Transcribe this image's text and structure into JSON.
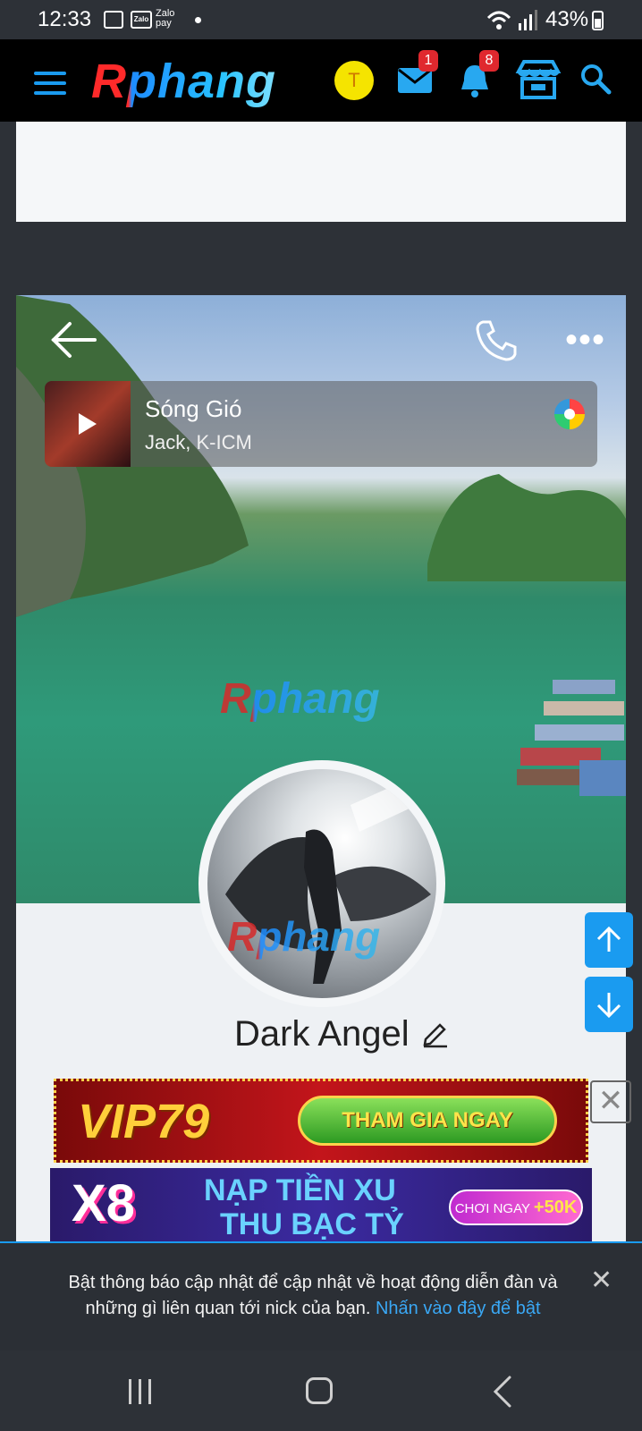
{
  "status_bar": {
    "time": "12:33",
    "app_icons": [
      "image-icon",
      "zalo-icon",
      "zalo-pay-icon"
    ],
    "zalo_label": "Zalo",
    "zalo_pay_label": "Zalo pay",
    "battery": "43%"
  },
  "header": {
    "brand": "Rphang",
    "user_initial": "T",
    "messages_count": "1",
    "notifications_count": "8",
    "icons": [
      "menu-icon",
      "mail-icon",
      "bell-icon",
      "store-icon",
      "search-icon"
    ],
    "accent_color": "#1a9bf0"
  },
  "cover": {
    "watermark": "Rphang",
    "music": {
      "title": "Sóng Gió",
      "artist": "Jack, K-ICM"
    }
  },
  "profile": {
    "name": "Dark Angel",
    "avatar_watermark": "Rphang"
  },
  "ads": {
    "ad1": {
      "logo": "VIP79",
      "button": "THAM GIA NGAY"
    },
    "ad2": {
      "logo": "X8",
      "line1": "NẠP TIỀN XU",
      "line2": "THU BẠC TỶ",
      "pill_label": "CHƠI NGAY",
      "pill_bonus": "+50K"
    }
  },
  "notification": {
    "message": "Bật thông báo cập nhật để cập nhật về hoạt động diễn đàn và những gì liên quan tới nick của bạn.",
    "link": "Nhấn vào đây để bật",
    "close": "✕"
  }
}
